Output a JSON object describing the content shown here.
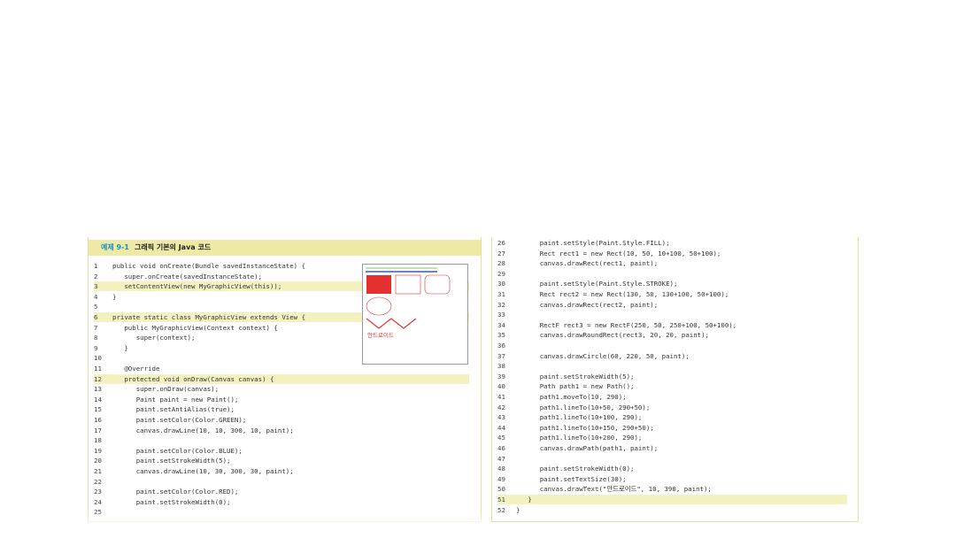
{
  "example": {
    "label": "예제 9-1",
    "title": "그래픽 기본의 Java 코드"
  },
  "left_code": [
    {
      "n": "1",
      "code": "public void onCreate(Bundle savedInstanceState) {",
      "hl": false
    },
    {
      "n": "2",
      "code": "   super.onCreate(savedInstanceState);",
      "hl": false
    },
    {
      "n": "3",
      "code": "   setContentView(new MyGraphicView(this));",
      "hl": true
    },
    {
      "n": "4",
      "code": "}",
      "hl": false
    },
    {
      "n": "5",
      "code": "",
      "hl": false
    },
    {
      "n": "6",
      "code": "private static class MyGraphicView extends View {",
      "hl": true
    },
    {
      "n": "7",
      "code": "   public MyGraphicView(Context context) {",
      "hl": false
    },
    {
      "n": "8",
      "code": "      super(context);",
      "hl": false
    },
    {
      "n": "9",
      "code": "   }",
      "hl": false
    },
    {
      "n": "10",
      "code": "",
      "hl": false
    },
    {
      "n": "11",
      "code": "   @Override",
      "hl": false
    },
    {
      "n": "12",
      "code": "   protected void onDraw(Canvas canvas) {",
      "hl": true
    },
    {
      "n": "13",
      "code": "      super.onDraw(canvas);",
      "hl": false
    },
    {
      "n": "14",
      "code": "      Paint paint = new Paint();",
      "hl": false
    },
    {
      "n": "15",
      "code": "      paint.setAntiAlias(true);",
      "hl": false
    },
    {
      "n": "16",
      "code": "      paint.setColor(Color.GREEN);",
      "hl": false
    },
    {
      "n": "17",
      "code": "      canvas.drawLine(10, 10, 300, 10, paint);",
      "hl": false
    },
    {
      "n": "18",
      "code": "",
      "hl": false
    },
    {
      "n": "19",
      "code": "      paint.setColor(Color.BLUE);",
      "hl": false
    },
    {
      "n": "20",
      "code": "      paint.setStrokeWidth(5);",
      "hl": false
    },
    {
      "n": "21",
      "code": "      canvas.drawLine(10, 30, 300, 30, paint);",
      "hl": false
    },
    {
      "n": "22",
      "code": "",
      "hl": false
    },
    {
      "n": "23",
      "code": "      paint.setColor(Color.RED);",
      "hl": false
    },
    {
      "n": "24",
      "code": "      paint.setStrokeWidth(0);",
      "hl": false
    },
    {
      "n": "25",
      "code": "",
      "hl": false
    }
  ],
  "right_code": [
    {
      "n": "26",
      "code": "      paint.setStyle(Paint.Style.FILL);",
      "hl": false
    },
    {
      "n": "27",
      "code": "      Rect rect1 = new Rect(10, 50, 10+100, 50+100);",
      "hl": false
    },
    {
      "n": "28",
      "code": "      canvas.drawRect(rect1, paint);",
      "hl": false
    },
    {
      "n": "29",
      "code": "",
      "hl": false
    },
    {
      "n": "30",
      "code": "      paint.setStyle(Paint.Style.STROKE);",
      "hl": false
    },
    {
      "n": "31",
      "code": "      Rect rect2 = new Rect(130, 50, 130+100, 50+100);",
      "hl": false
    },
    {
      "n": "32",
      "code": "      canvas.drawRect(rect2, paint);",
      "hl": false
    },
    {
      "n": "33",
      "code": "",
      "hl": false
    },
    {
      "n": "34",
      "code": "      RectF rect3 = new RectF(250, 50, 250+100, 50+100);",
      "hl": false
    },
    {
      "n": "35",
      "code": "      canvas.drawRoundRect(rect3, 20, 20, paint);",
      "hl": false
    },
    {
      "n": "36",
      "code": "",
      "hl": false
    },
    {
      "n": "37",
      "code": "      canvas.drawCircle(60, 220, 50, paint);",
      "hl": false
    },
    {
      "n": "38",
      "code": "",
      "hl": false
    },
    {
      "n": "39",
      "code": "      paint.setStrokeWidth(5);",
      "hl": false
    },
    {
      "n": "40",
      "code": "      Path path1 = new Path();",
      "hl": false
    },
    {
      "n": "41",
      "code": "      path1.moveTo(10, 290);",
      "hl": false
    },
    {
      "n": "42",
      "code": "      path1.lineTo(10+50, 290+50);",
      "hl": false
    },
    {
      "n": "43",
      "code": "      path1.lineTo(10+100, 290);",
      "hl": false
    },
    {
      "n": "44",
      "code": "      path1.lineTo(10+150, 290+50);",
      "hl": false
    },
    {
      "n": "45",
      "code": "      path1.lineTo(10+200, 290);",
      "hl": false
    },
    {
      "n": "46",
      "code": "      canvas.drawPath(path1, paint);",
      "hl": false
    },
    {
      "n": "47",
      "code": "",
      "hl": false
    },
    {
      "n": "48",
      "code": "      paint.setStrokeWidth(0);",
      "hl": false
    },
    {
      "n": "49",
      "code": "      paint.setTextSize(30);",
      "hl": false
    },
    {
      "n": "50",
      "code": "      canvas.drawText(\"안드로이드\", 10, 390, paint);",
      "hl": false
    },
    {
      "n": "51",
      "code": "   }",
      "hl": true
    },
    {
      "n": "52",
      "code": "}",
      "hl": false
    }
  ],
  "preview": {
    "text": "안드로이드",
    "colors": {
      "green": "#4caf50",
      "blue": "#3a5fa8",
      "red": "#e53030"
    }
  },
  "colors": {
    "title_bar": "#eeeaa6",
    "label": "#1a8fc9",
    "highlight": "#f3f1c0"
  }
}
